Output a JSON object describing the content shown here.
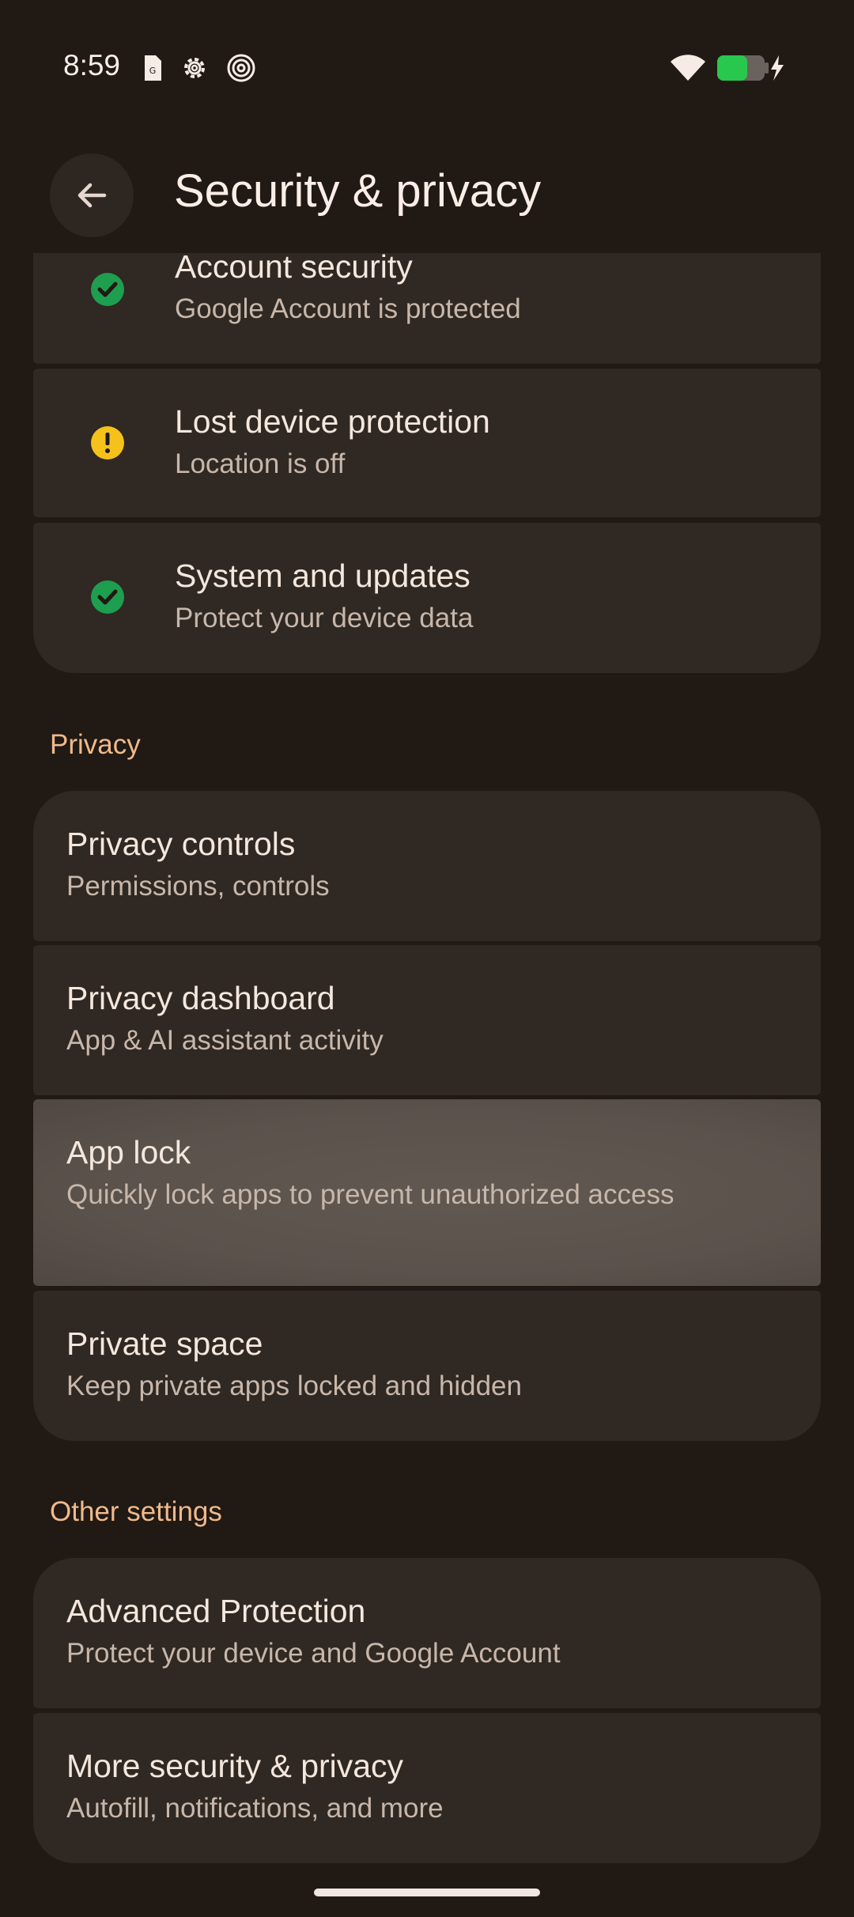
{
  "status_bar": {
    "time": "8:59"
  },
  "header": {
    "title": "Security & privacy"
  },
  "security_items": [
    {
      "title": "Account security",
      "subtitle": "Google Account is protected",
      "status": "ok",
      "icon": "check-circle-icon",
      "color": "#1e9e4f"
    },
    {
      "title": "Lost device protection",
      "subtitle": "Location is off",
      "status": "warning",
      "icon": "warning-circle-icon",
      "color": "#f5c11b"
    },
    {
      "title": "System and updates",
      "subtitle": "Protect your device data",
      "status": "ok",
      "icon": "check-circle-icon",
      "color": "#1e9e4f"
    }
  ],
  "privacy": {
    "header": "Privacy",
    "items": [
      {
        "title": "Privacy controls",
        "subtitle": "Permissions, controls"
      },
      {
        "title": "Privacy dashboard",
        "subtitle": "App & AI assistant activity"
      },
      {
        "title": "App lock",
        "subtitle": "Quickly lock apps to prevent unauthorized access"
      },
      {
        "title": "Private space",
        "subtitle": "Keep private apps locked and hidden"
      }
    ]
  },
  "other": {
    "header": "Other settings",
    "items": [
      {
        "title": "Advanced Protection",
        "subtitle": "Protect your device and Google Account"
      },
      {
        "title": "More security & privacy",
        "subtitle": "Autofill, notifications, and more"
      }
    ]
  },
  "colors": {
    "background": "#201914",
    "card": "#302822",
    "accent": "#f0b98b",
    "pressed": "#5a524b"
  }
}
